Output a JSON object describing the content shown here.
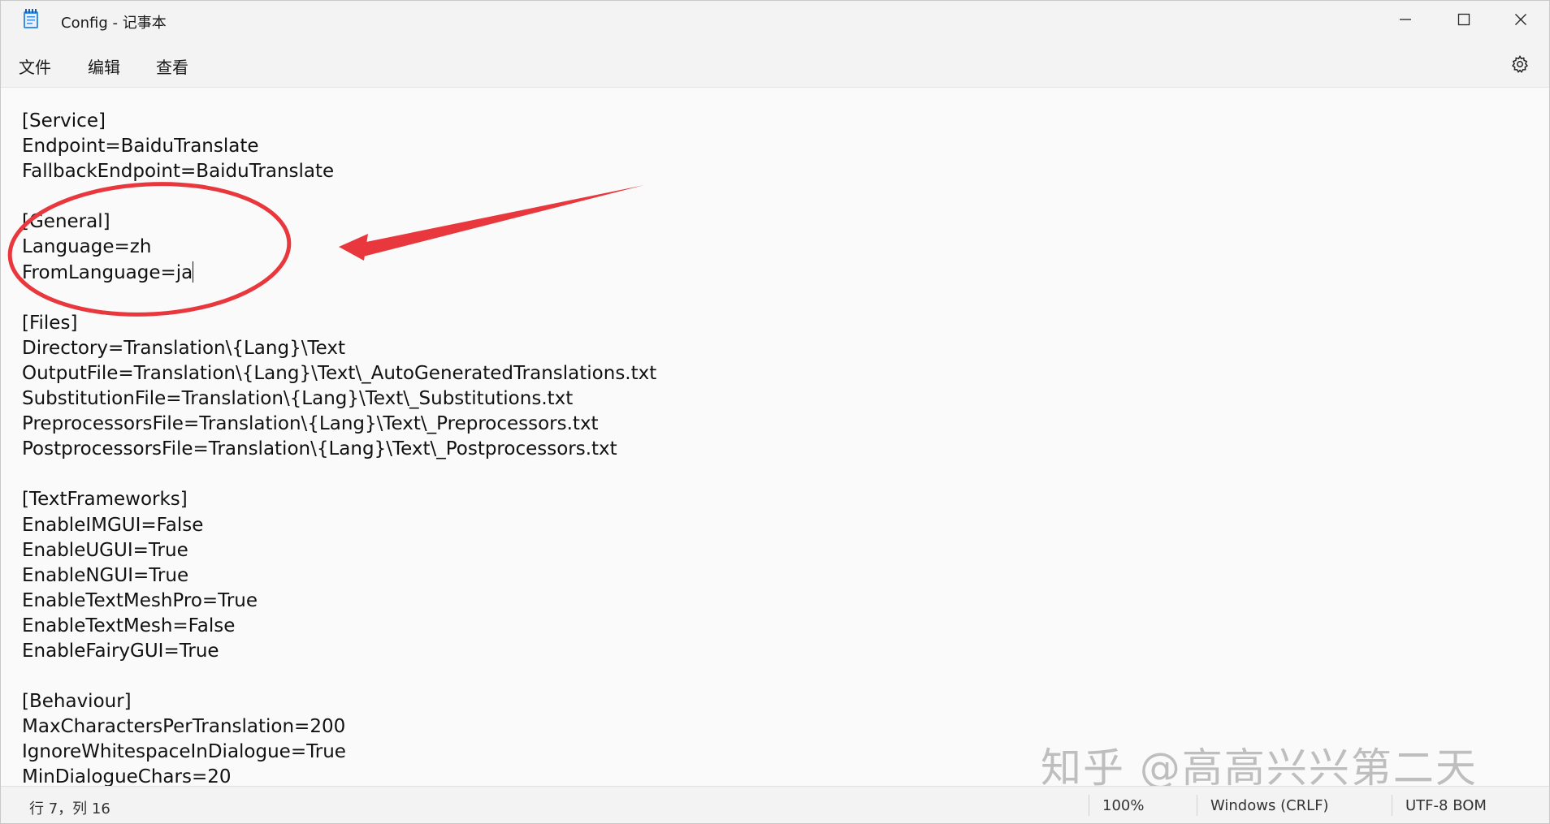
{
  "window": {
    "title": "Config - 记事本"
  },
  "titlebar_icons": {
    "app": "notepad-icon",
    "minimize": "minimize-icon",
    "maximize": "maximize-icon",
    "close": "close-icon"
  },
  "menu": {
    "file": "文件",
    "edit": "编辑",
    "view": "查看",
    "settings_icon": "gear-icon"
  },
  "editor": {
    "lines": [
      "[Service]",
      "Endpoint=BaiduTranslate",
      "FallbackEndpoint=BaiduTranslate",
      "",
      "[General]",
      "Language=zh",
      "FromLanguage=ja",
      "",
      "[Files]",
      "Directory=Translation\\{Lang}\\Text",
      "OutputFile=Translation\\{Lang}\\Text\\_AutoGeneratedTranslations.txt",
      "SubstitutionFile=Translation\\{Lang}\\Text\\_Substitutions.txt",
      "PreprocessorsFile=Translation\\{Lang}\\Text\\_Preprocessors.txt",
      "PostprocessorsFile=Translation\\{Lang}\\Text\\_Postprocessors.txt",
      "",
      "[TextFrameworks]",
      "EnableIMGUI=False",
      "EnableUGUI=True",
      "EnableNGUI=True",
      "EnableTextMeshPro=True",
      "EnableTextMesh=False",
      "EnableFairyGUI=True",
      "",
      "[Behaviour]",
      "MaxCharactersPerTranslation=200",
      "IgnoreWhitespaceInDialogue=True",
      "MinDialogueChars=20"
    ],
    "annotation_color": "#e8383d"
  },
  "watermark": "知乎 @高高兴兴第二天",
  "status": {
    "position": "行 7，列 16",
    "zoom": "100%",
    "line_ending": "Windows (CRLF)",
    "encoding": "UTF-8 BOM"
  }
}
